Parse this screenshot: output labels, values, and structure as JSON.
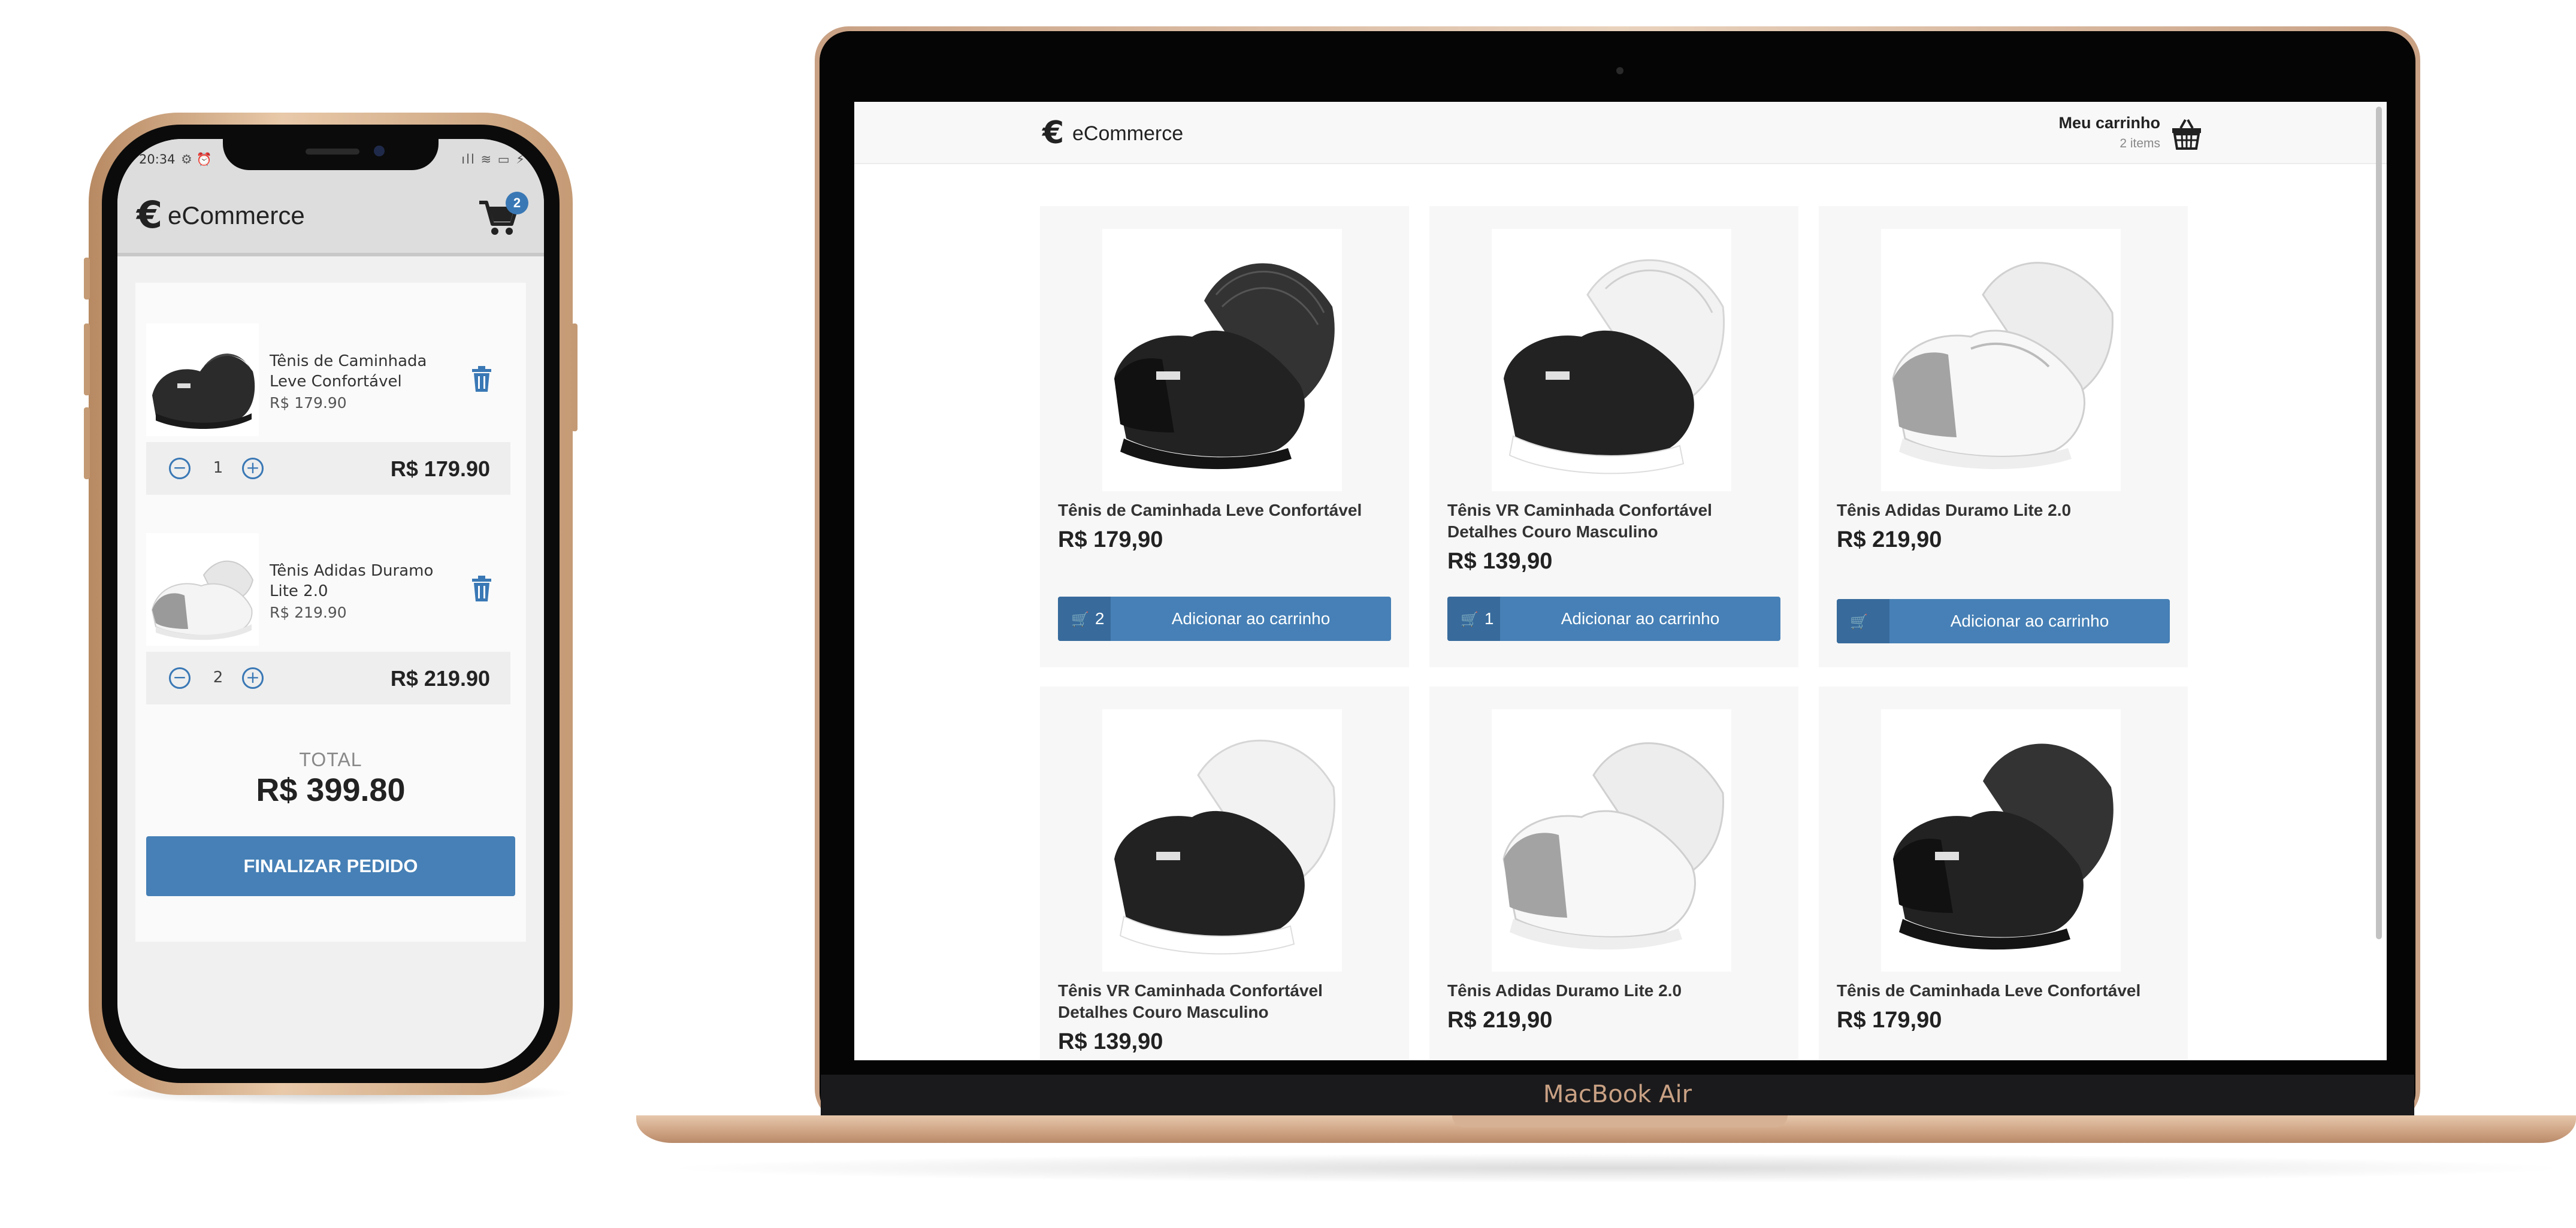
{
  "phone": {
    "status": {
      "time": "20:34",
      "left_icons": "⚙ ⏰",
      "right_icons": "ıll ≋ ▭ ⚡"
    },
    "header": {
      "logo_symbol": "€",
      "logo_text": "eCommerce",
      "cart_count": "2"
    },
    "cart_items": [
      {
        "name": "Tênis de Caminhada Leve Confortável",
        "unit_price": "R$ 179.90",
        "quantity": "1",
        "line_total": "R$ 179.90",
        "shoe_color": "black"
      },
      {
        "name": "Tênis Adidas Duramo Lite 2.0",
        "unit_price": "R$ 219.90",
        "quantity": "2",
        "line_total": "R$ 219.90",
        "shoe_color": "white-grey"
      }
    ],
    "total_label": "TOTAL",
    "total_value": "R$ 399.80",
    "checkout_label": "FINALIZAR PEDIDO"
  },
  "laptop": {
    "brand_label": "MacBook Air",
    "nav": {
      "logo_symbol": "€",
      "logo_text": "eCommerce",
      "cart_title": "Meu carrinho",
      "cart_items": "2 items"
    },
    "add_label": "Adicionar ao carrinho",
    "products": [
      {
        "name": "Tênis de Caminhada Leve Confortável",
        "price": "R$ 179,90",
        "in_cart": "2",
        "shoe_color": "black"
      },
      {
        "name": "Tênis VR Caminhada Confortável Detalhes Couro Masculino",
        "price": "R$ 139,90",
        "in_cart": "1",
        "shoe_color": "white-black"
      },
      {
        "name": "Tênis Adidas Duramo Lite 2.0",
        "price": "R$ 219,90",
        "in_cart": "",
        "shoe_color": "white-grey"
      },
      {
        "name": "Tênis VR Caminhada Confortável Detalhes Couro Masculino",
        "price": "R$ 139,90",
        "in_cart": "",
        "shoe_color": "white-black"
      },
      {
        "name": "Tênis Adidas Duramo Lite 2.0",
        "price": "R$ 219,90",
        "in_cart": "",
        "shoe_color": "white-grey"
      },
      {
        "name": "Tênis de Caminhada Leve Confortável",
        "price": "R$ 179,90",
        "in_cart": "",
        "shoe_color": "black"
      }
    ]
  },
  "colors": {
    "primary": "#4680b6",
    "primary_dark": "#386b9c",
    "badge": "#3a78b5"
  },
  "icons": [
    "euro-logo-icon",
    "cart-icon",
    "trash-icon",
    "minus-icon",
    "plus-icon",
    "basket-icon",
    "cart-small-icon"
  ]
}
